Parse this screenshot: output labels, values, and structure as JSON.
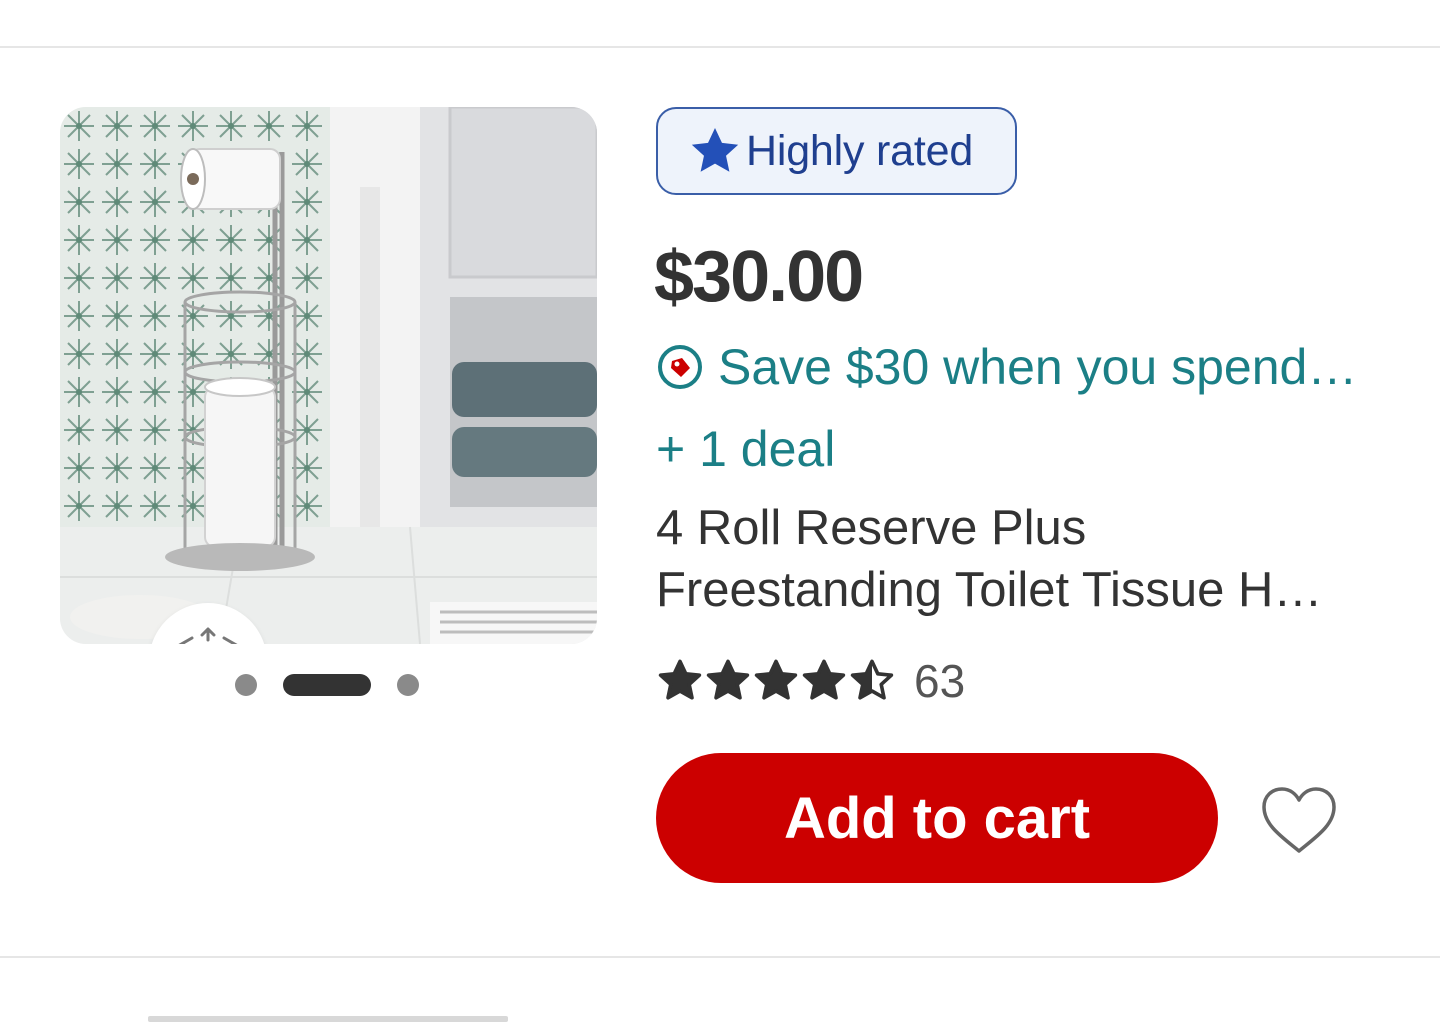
{
  "product": {
    "badge": {
      "label": "Highly rated",
      "icon": "star-icon"
    },
    "price": "$30.00",
    "promo": {
      "text": "Save $30 when you spend…",
      "icon": "deal-tag-icon"
    },
    "deals_link": "+ 1 deal",
    "title_lines": [
      "4 Roll Reserve Plus",
      "Freestanding Toilet Tissue H…"
    ],
    "rating": {
      "stars": 4.5,
      "out_of": 5,
      "count": "63"
    },
    "add_to_cart_label": "Add to cart",
    "favorite_icon": "heart-outline-icon"
  },
  "carousel": {
    "count": 3,
    "active_index": 1
  },
  "colors": {
    "primary_red": "#cc0000",
    "promo_teal": "#1b7f86",
    "badge_blue": "#1f3f8f",
    "badge_bg": "#eef3fb",
    "text_dark": "#333333"
  }
}
